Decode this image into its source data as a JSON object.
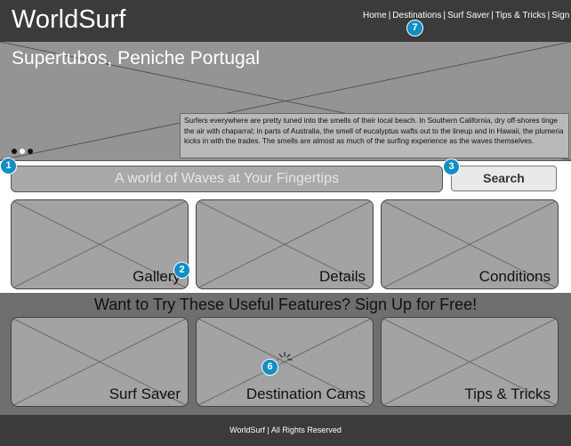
{
  "header": {
    "logo": "WorldSurf",
    "nav": [
      "Home",
      "Destinations",
      "Surf Saver",
      "Tips & Tricks",
      "Sign In"
    ]
  },
  "hero": {
    "title": "Supertubos, Peniche Portugal",
    "description": "Surfers everywhere are pretty tuned into the smells of their local beach. In Southern California, dry off-shores tinge the air with chaparral; in parts of Australia, the smell of eucalyptus wafts out to the lineup and in Hawaii, the plumeria kicks in with the trades. The smells are almost as much of the surfing experience as the waves themselves."
  },
  "search": {
    "placeholder": "A world of Waves at Your Fingertips",
    "button": "Search"
  },
  "tiles": [
    "Gallery",
    "Details",
    "Conditions"
  ],
  "signup": {
    "title": "Want to Try These Useful Features? Sign Up for Free!",
    "features": [
      "Surf Saver",
      "Destination Cams",
      "Tips & Tricks"
    ]
  },
  "footer": {
    "text": "WorldSurf | All Rights Reserved"
  },
  "annotations": [
    "1",
    "2",
    "3",
    "6",
    "7"
  ],
  "colors": {
    "dark": "#3b3b3b",
    "badge": "#0f8fc7"
  }
}
